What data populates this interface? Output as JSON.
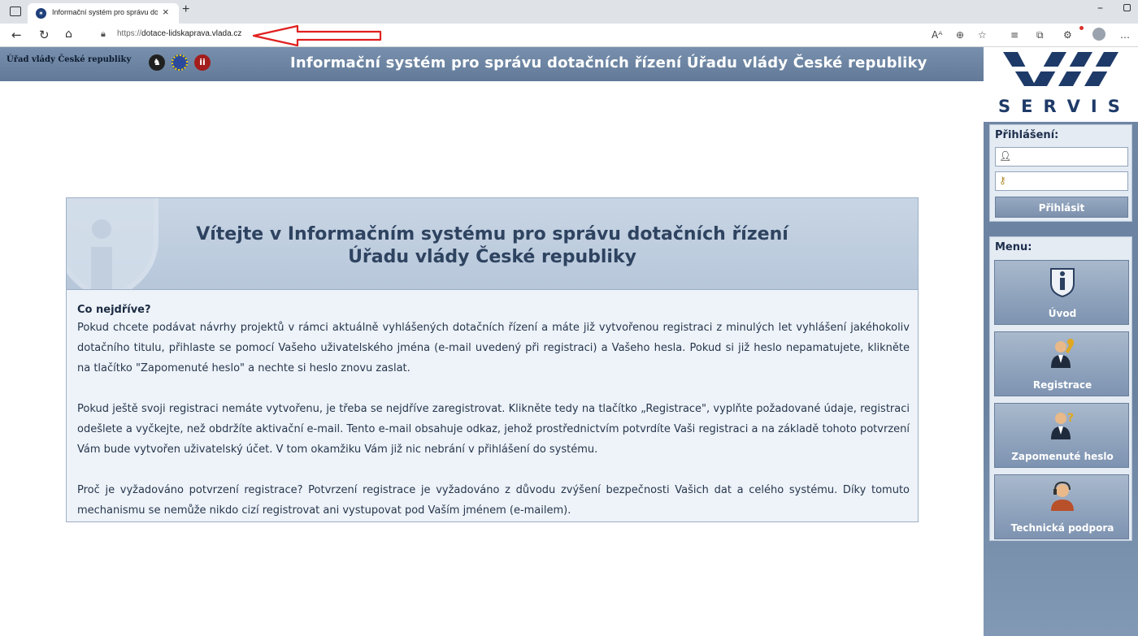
{
  "browser": {
    "tab_title": "Informační systém pro správu do",
    "tab_close": "×",
    "new_tab": "+",
    "url_scheme": "https://",
    "url_host": "dotace-lidskaprava.vlada.cz",
    "toolbar_icons": [
      "read-aloud-icon",
      "zoom-icon",
      "favorite-star-icon",
      "favorites-icon",
      "collections-icon",
      "extensions-icon",
      "profile-icon",
      "more-icon"
    ]
  },
  "header": {
    "office_name": "Úřad vlády České republiky",
    "title": "Informační systém pro správu dotačních řízení Úřadu vlády České republiky"
  },
  "sidebar": {
    "logo_text": "SERVIS",
    "login": {
      "heading": "Přihlášení:",
      "button": "Přihlásit"
    },
    "menu": {
      "heading": "Menu:",
      "items": [
        {
          "label": "Úvod",
          "icon": "info-shield-icon"
        },
        {
          "label": "Registrace",
          "icon": "user-key-icon"
        },
        {
          "label": "Zapomenuté heslo",
          "icon": "user-question-icon"
        },
        {
          "label": "Technická podpora",
          "icon": "support-headset-icon"
        }
      ]
    }
  },
  "main": {
    "title_line1": "Vítejte v Informačním systému pro správu dotačních řízení",
    "title_line2": "Úřadu vlády České republiky",
    "heading": "Co nejdříve?",
    "paragraphs": [
      "Pokud chcete podávat návrhy projektů v rámci aktuálně vyhlášených dotačních řízení a máte již vytvořenou registraci z minulých let vyhlášení jakéhokoliv dotačního titulu, přihlaste se pomocí Vašeho uživatelského jména (e-mail uvedený při registraci) a Vašeho hesla. Pokud si již heslo nepamatujete, klikněte na tlačítko \"Zapomenuté heslo\" a nechte si heslo znovu zaslat.",
      "Pokud ještě svoji registraci nemáte vytvořenu, je třeba se nejdříve zaregistrovat. Klikněte tedy na tlačítko „Registrace\", vyplňte požadované údaje, registraci odešlete a vyčkejte, než obdržíte aktivační e-mail. Tento e-mail obsahuje odkaz, jehož prostřednictvím potvrdíte Vaši registraci a na základě tohoto potvrzení Vám bude vytvořen uživatelský účet. V tom okamžiku Vám již nic nebrání v přihlášení do systému.",
      "Proč je vyžadováno potvrzení registrace? Potvrzení registrace je vyžadováno z důvodu zvýšení bezpečnosti Vašich dat a celého systému. Díky tomuto mechanismu se nemůže nikdo cizí registrovat ani vystupovat pod Vaším jménem (e-mailem)."
    ]
  },
  "colors": {
    "header_bg": "#6b83a1",
    "sidebar_bg": "#6f86a4",
    "panel_bg": "#e4ebf3",
    "content_bg": "#eef3f9",
    "annotation_arrow": "#e02020"
  }
}
